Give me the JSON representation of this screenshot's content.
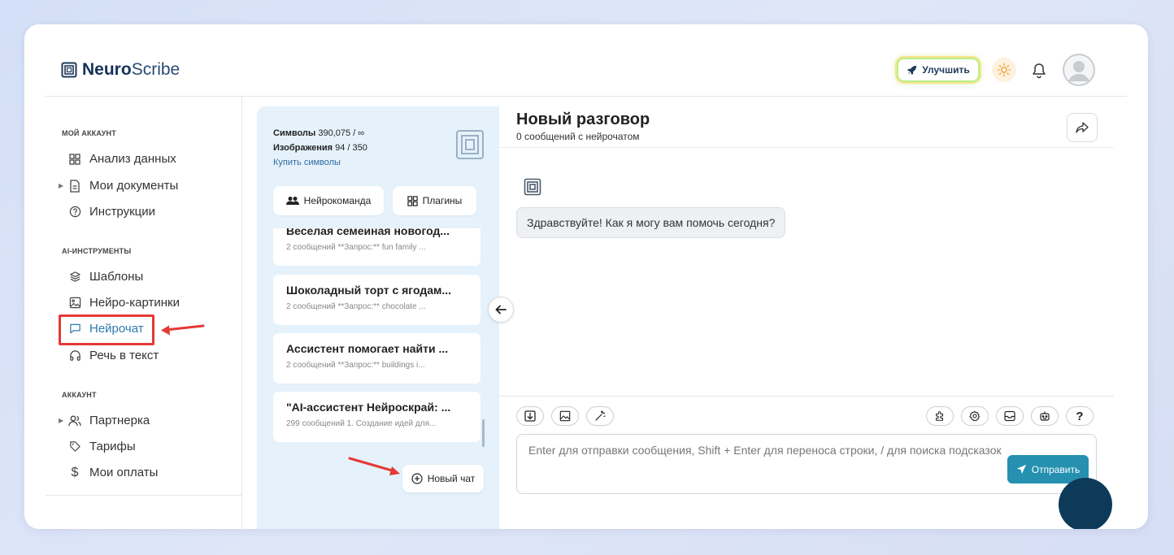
{
  "header": {
    "logo_bold": "Neuro",
    "logo_rest": "Scribe",
    "upgrade_label": "Улучшить"
  },
  "sidebar": {
    "sections": [
      {
        "title": "МОЙ АККАУНТ",
        "items": [
          {
            "label": "Анализ данных",
            "icon": "grid-icon"
          },
          {
            "label": "Мои документы",
            "icon": "document-icon"
          },
          {
            "label": "Инструкции",
            "icon": "help-circle-icon"
          }
        ]
      },
      {
        "title": "AI-ИНСТРУМЕНТЫ",
        "items": [
          {
            "label": "Шаблоны",
            "icon": "layers-icon"
          },
          {
            "label": "Нейро-картинки",
            "icon": "image-icon"
          },
          {
            "label": "Нейрочат",
            "icon": "chat-icon"
          },
          {
            "label": "Речь в текст",
            "icon": "headphones-icon"
          }
        ]
      },
      {
        "title": "АККАУНТ",
        "items": [
          {
            "label": "Партнерка",
            "icon": "users-icon"
          },
          {
            "label": "Тарифы",
            "icon": "tag-icon"
          },
          {
            "label": "Мои оплаты",
            "icon": "dollar-icon"
          }
        ]
      }
    ],
    "active_color": "#2f7ab0"
  },
  "panel": {
    "symbols_label": "Символы",
    "symbols_value": "390,075 / ∞",
    "images_label": "Изображения",
    "images_value": "94 / 350",
    "buy_label": "Купить символы",
    "team_label": "Нейрокоманда",
    "plugins_label": "Плагины",
    "chats": [
      {
        "title": "Веселая семейная новогод...",
        "sub": "2 сообщений   **Запрос:** fun family ..."
      },
      {
        "title": "Шоколадный торт с ягодам...",
        "sub": "2 сообщений   **Запрос:** chocolate ..."
      },
      {
        "title": "Ассистент помогает найти ...",
        "sub": "2 сообщений   **Запрос:** buildings i..."
      },
      {
        "title": "\"AI-ассистент Нейроскрай: ...",
        "sub": "299 сообщений 1. Создание идей для..."
      }
    ],
    "new_chat_label": "Новый чат"
  },
  "main": {
    "title": "Новый разговор",
    "subtitle": "0 сообщений с нейрочатом",
    "greeting": "Здравствуйте! Как я могу вам помочь сегодня?",
    "placeholder": "Enter для отправки сообщения, Shift + Enter для переноса строки, / для поиска подсказок",
    "send_label": "Отправить",
    "help_label": "?"
  },
  "colors": {
    "accent": "#2590b0",
    "highlight": "#e53935",
    "panel_bg": "#e5f2fb"
  }
}
